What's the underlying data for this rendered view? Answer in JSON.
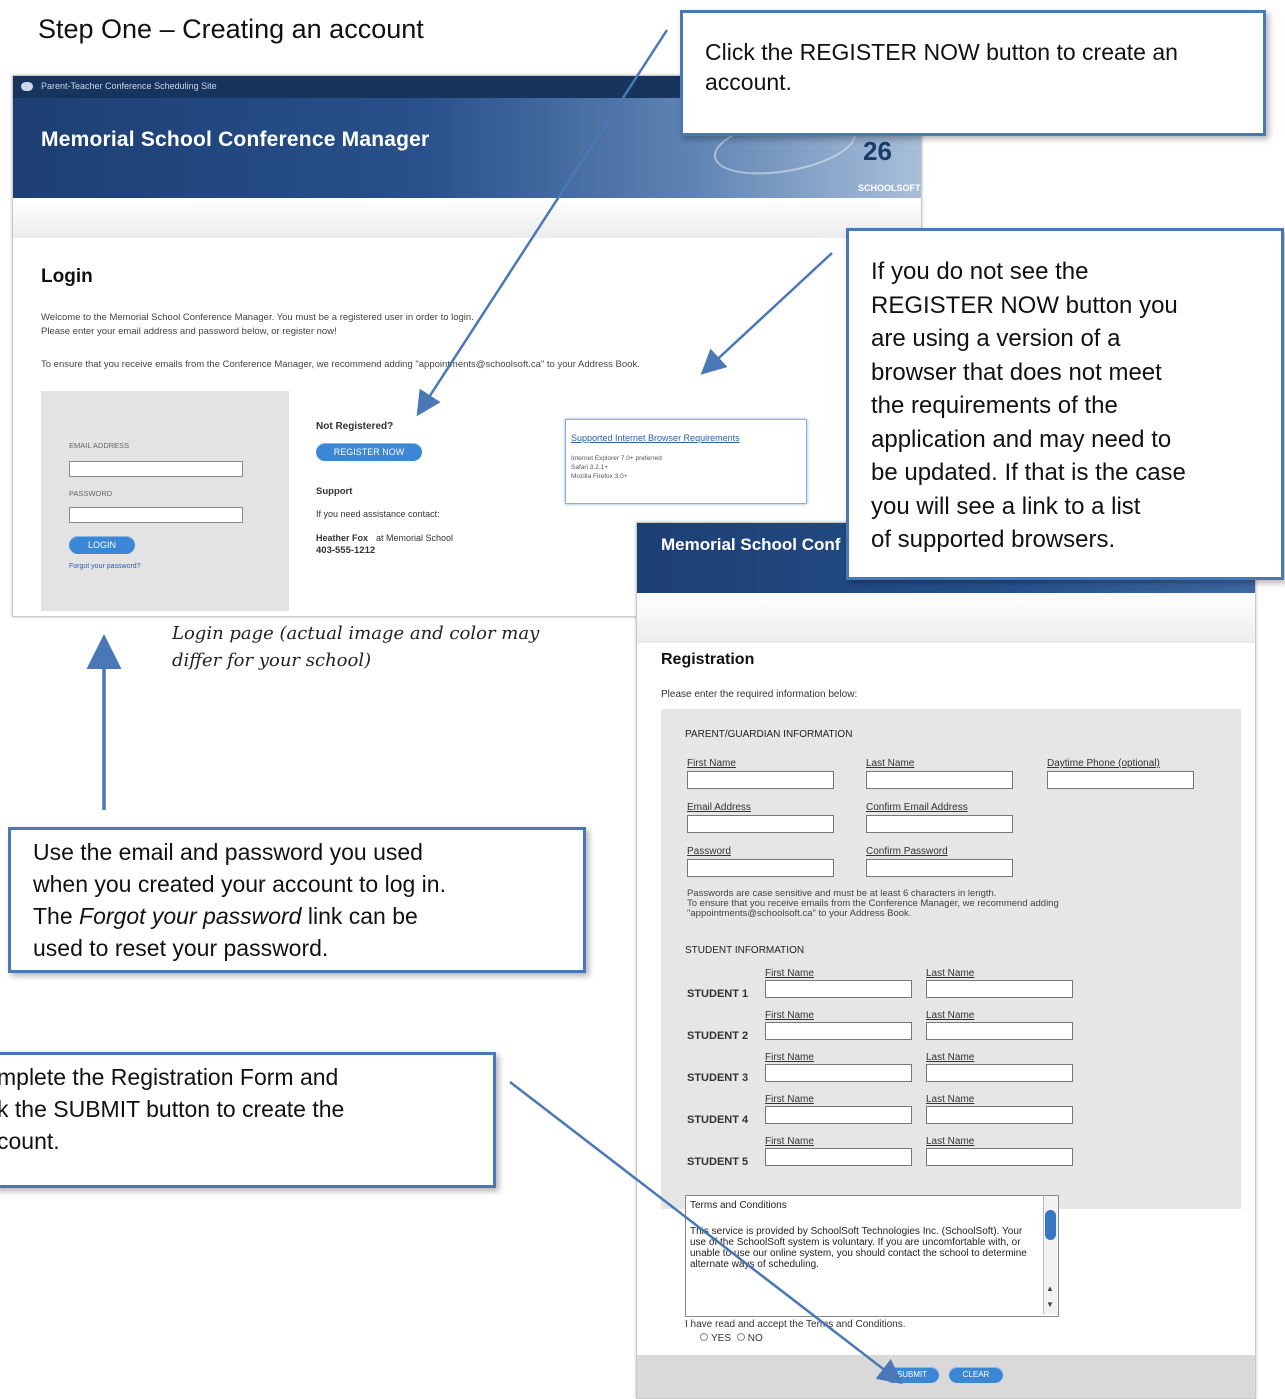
{
  "step_title": "Step One – Creating an account",
  "login": {
    "topbar": "Parent-Teacher Conference Scheduling Site",
    "banner_title": "Memorial School Conference Manager",
    "banner_number": "26",
    "banner_logo": "SCHOOLSOFT",
    "heading": "Login",
    "welcome_line1": "Welcome to the Memorial School Conference Manager. You must be a registered user in order to login.",
    "welcome_line2": "Please enter your email address and password below, or register now!",
    "ensure_line": "To ensure that you receive emails from the Conference Manager, we recommend adding \"appointments@schoolsoft.ca\" to your Address Book.",
    "email_label": "EMAIL ADDRESS",
    "password_label": "PASSWORD",
    "login_button": "LOGIN",
    "forgot_link": "Forgot your password?",
    "not_registered": "Not Registered?",
    "register_button": "REGISTER NOW",
    "support_heading": "Support",
    "support_text": "If you need assistance contact:",
    "support_name": "Heather Fox",
    "support_at": "at Memorial School",
    "support_phone": "403-555-1212",
    "browser_link": "Supported Internet Browser Requirements",
    "browser_lines": [
      "Internet Explorer 7.0+ preferred",
      "Safari 3.2.1+",
      "Mozilla Firefox 3.0+"
    ]
  },
  "registration": {
    "banner_title": "Memorial School Conf",
    "heading": "Registration",
    "intro": "Please enter the required information below:",
    "parent_section": "PARENT/GUARDIAN INFORMATION",
    "first_name": "First Name",
    "last_name": "Last Name",
    "daytime_phone": "Daytime Phone (optional)",
    "email": "Email Address",
    "confirm_email": "Confirm Email Address",
    "password": "Password",
    "confirm_password": "Confirm Password",
    "note_line1": "Passwords are case sensitive and must be at least 6 characters in length.",
    "note_line2": "To ensure that you receive emails from the Conference Manager, we recommend adding",
    "note_line3": "\"appointments@schoolsoft.ca\" to your Address Book.",
    "student_section": "STUDENT INFORMATION",
    "students": [
      "STUDENT 1",
      "STUDENT 2",
      "STUDENT 3",
      "STUDENT 4",
      "STUDENT 5"
    ],
    "student_first": "First Name",
    "student_last": "Last Name",
    "terms_title": "Terms and Conditions",
    "terms_text": "This service is provided by SchoolSoft Technologies Inc. (SchoolSoft). Your use of the SchoolSoft system is voluntary. If you are uncomfortable with, or unable to use our online system, you should contact the school to determine alternate ways of scheduling.",
    "accept_text": "I have read and accept the Terms and Conditions.",
    "yes": "YES",
    "no": "NO",
    "submit": "SUBMIT",
    "clear": "CLEAR"
  },
  "callouts": {
    "register": "Click the REGISTER NOW button to create an account.",
    "browser": [
      "If you do not see the",
      "REGISTER NOW button you",
      "are using a version of a",
      "browser that does not meet",
      "the requirements of the",
      "application and may need to",
      "be updated.  If that is the case",
      "you will see a link to a list",
      "of supported browsers."
    ],
    "login": [
      "Use the email and password you used",
      "when you created your account to log in."
    ],
    "login_pre": "The ",
    "login_em": "Forgot your password",
    "login_post": " link can be",
    "login_last": "used to reset your password.",
    "submit": [
      "mplete the Registration Form and",
      "k the SUBMIT button to create the",
      "count."
    ]
  },
  "caption": "Login page (actual image and color may differ for your school)",
  "colors": {
    "banner": "#1d3f73",
    "button": "#3c86d6",
    "callout_border": "#4a78b6"
  }
}
